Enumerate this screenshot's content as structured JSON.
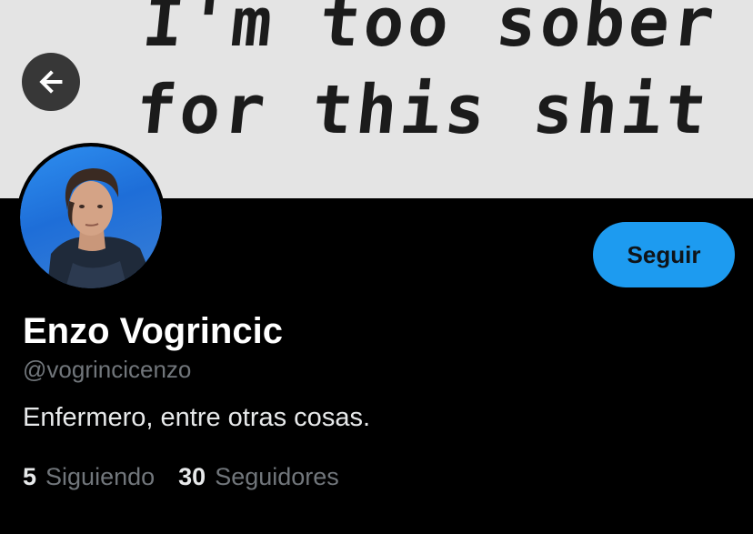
{
  "banner": {
    "line1": "I'm too sober",
    "line2": "for this shit"
  },
  "header": {
    "back_icon": "arrow-left-icon"
  },
  "profile": {
    "display_name": "Enzo Vogrincic",
    "handle": "@vogrincicenzo",
    "bio": "Enfermero, entre otras cosas.",
    "follow_label": "Seguir",
    "accent_color": "#1d9bf0"
  },
  "stats": {
    "following_count": "5",
    "following_label": "Siguiendo",
    "followers_count": "30",
    "followers_label": "Seguidores"
  }
}
